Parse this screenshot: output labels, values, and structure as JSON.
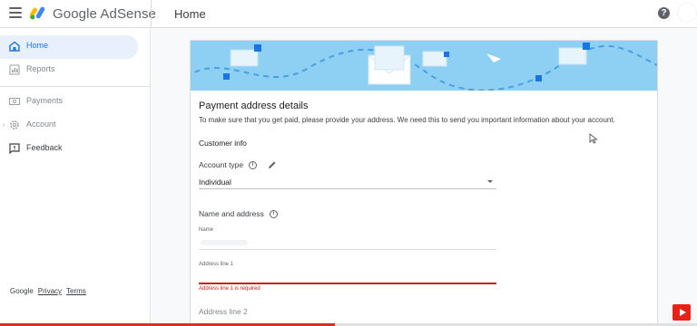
{
  "app": {
    "brand": "Google AdSense",
    "page_title": "Home",
    "help_icon": "?"
  },
  "sidebar": {
    "items": [
      {
        "label": "Home",
        "icon": "home-icon",
        "active": true
      },
      {
        "label": "Reports",
        "icon": "reports-icon"
      },
      {
        "label": "Payments",
        "icon": "payments-icon"
      },
      {
        "label": "Account",
        "icon": "gear-icon"
      },
      {
        "label": "Feedback",
        "icon": "feedback-icon"
      }
    ],
    "footer": {
      "google": "Google",
      "privacy": "Privacy",
      "terms": "Terms"
    }
  },
  "form": {
    "title": "Payment address details",
    "description": "To make sure that you get paid, please provide your address. We need this to send you important information about your account.",
    "customer_info": "Customer info",
    "account_type_label": "Account type",
    "account_type_value": "Individual",
    "name_address_label": "Name and address",
    "name_small_label": "Name",
    "address1_small_label": "Address line 1",
    "address1_error": "Address line 1 is required",
    "address2_placeholder": "Address line 2"
  },
  "colors": {
    "accent": "#1a73e8",
    "banner": "#8ed0f3",
    "error": "#c5221f",
    "active_nav_bg": "#e8f0fe"
  },
  "video_progress": 0.48
}
